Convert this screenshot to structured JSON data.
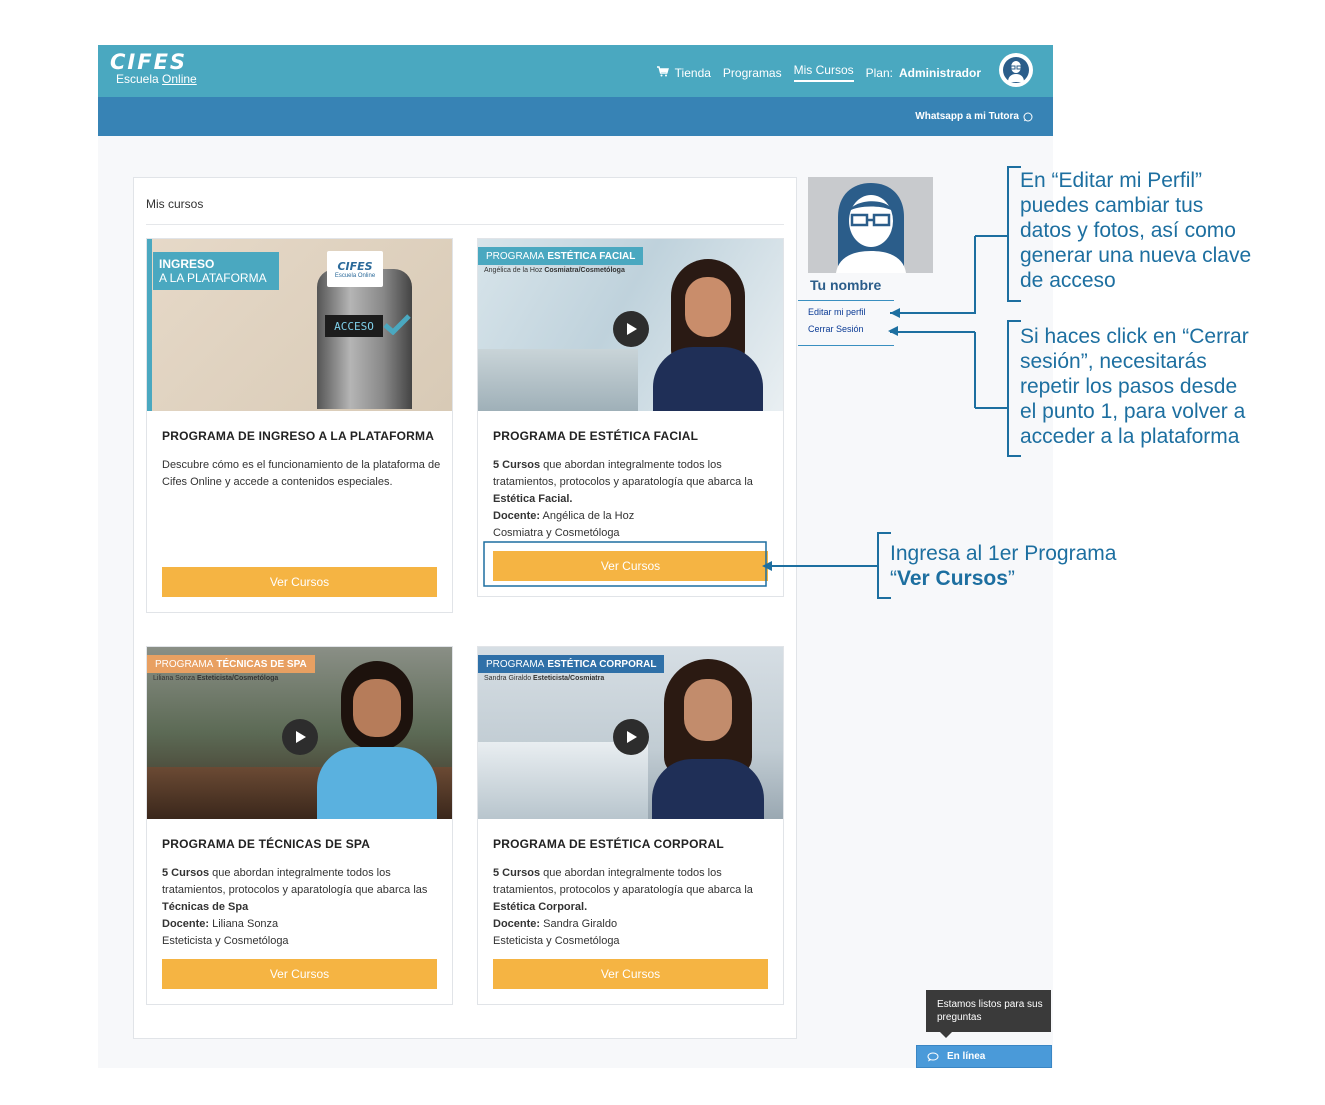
{
  "header": {
    "logo_text": "CIFES",
    "logo_sub_a": "Escuela",
    "logo_sub_b": "Online",
    "nav": {
      "shop": "Tienda",
      "programs": "Programas",
      "my_courses": "Mis Cursos",
      "plan_label": "Plan:",
      "plan_value": "Administrador"
    },
    "whatsapp": "Whatsapp a mi Tutora"
  },
  "panel": {
    "title": "Mis cursos"
  },
  "cards": [
    {
      "img_banner_a": "INGRESO",
      "img_banner_b": "A LA PLATAFORMA",
      "img_logo": "CIFES",
      "img_logo_sub": "Escuela Online",
      "img_screen": "ACCESO",
      "title": "PROGRAMA DE INGRESO A LA PLATAFORMA",
      "desc": "Descubre cómo es el funcionamiento de la plataforma de Cifes Online y accede a contenidos especiales.",
      "button": "Ver Cursos"
    },
    {
      "banner_pre": "PROGRAMA",
      "banner_bold": "ESTÉTICA FACIAL",
      "banner_name": "Angélica de la Hoz",
      "banner_role": "Cosmiatra/Cosmetóloga",
      "title": "PROGRAMA DE ESTÉTICA FACIAL",
      "desc_bold1": "5 Cursos",
      "desc_text1": " que abordan integralmente todos los tratamientos, protocolos y aparatología que abarca la ",
      "desc_bold2": "Estética Facial.",
      "teacher_label": "Docente:",
      "teacher_name": " Angélica de la Hoz",
      "teacher_role": "Cosmiatra y Cosmetóloga",
      "button": "Ver Cursos"
    },
    {
      "banner_pre": "PROGRAMA",
      "banner_bold": "TÉCNICAS DE SPA",
      "banner_name": "Liliana Sonza",
      "banner_role": "Esteticista/Cosmetóloga",
      "title": "PROGRAMA DE TÉCNICAS DE SPA",
      "desc_bold1": "5 Cursos",
      "desc_text1": " que abordan integralmente todos los tratamientos, protocolos y aparatología que abarca las ",
      "desc_bold2": "Técnicas de Spa",
      "teacher_label": "Docente:",
      "teacher_name": " Liliana Sonza",
      "teacher_role": "Esteticista y Cosmetóloga",
      "button": "Ver Cursos"
    },
    {
      "banner_pre": "PROGRAMA",
      "banner_bold": "ESTÉTICA CORPORAL",
      "banner_name": "Sandra Giraldo",
      "banner_role": "Esteticista/Cosmiatra",
      "title": "PROGRAMA DE ESTÉTICA CORPORAL",
      "desc_bold1": "5 Cursos",
      "desc_text1": " que abordan integralmente todos los tratamientos, protocolos y aparatología que abarca la ",
      "desc_bold2": "Estética Corporal.",
      "teacher_label": "Docente:",
      "teacher_name": " Sandra Giraldo",
      "teacher_role": "Esteticista y Cosmetóloga",
      "button": "Ver Cursos"
    }
  ],
  "profile": {
    "name": "Tu nombre",
    "edit": "Editar mi perfil",
    "logout": "Cerrar Sesión"
  },
  "chat": {
    "tooltip": "Estamos listos para sus preguntas",
    "status": "En línea"
  },
  "annotations": {
    "edit_profile": [
      "En “Editar mi Perfil”",
      "puedes cambiar tus",
      "datos y fotos, así como",
      "generar una nueva clave",
      "de acceso"
    ],
    "logout": [
      "Si haces click en “Cerrar",
      "sesión”, necesitarás",
      "repetir los pasos desde",
      "el punto 1, para volver a",
      "acceder a la plataforma"
    ],
    "enter_a": "Ingresa al 1er Programa",
    "enter_q1": "“",
    "enter_b": "Ver Cursos",
    "enter_q2": "”"
  },
  "colors": {
    "topbar": "#4aa8c0",
    "subbar": "#3783b5",
    "button": "#f5b443",
    "annotation": "#1d6fa0"
  }
}
